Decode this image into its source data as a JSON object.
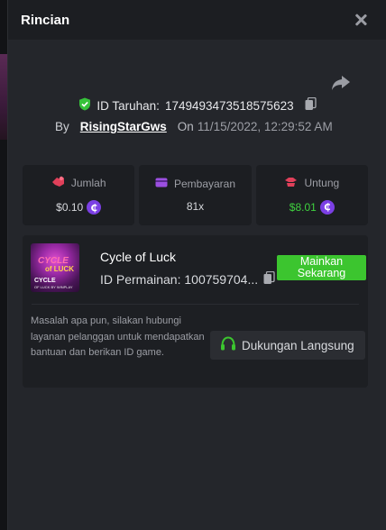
{
  "modal": {
    "title": "Rincian"
  },
  "bet": {
    "id_label": "ID Taruhan:",
    "id_value": "1749493473518575623",
    "by_label": "By",
    "username": "RisingStarGws",
    "on_label": "On",
    "datetime": "11/15/2022, 12:29:52 AM"
  },
  "stats": [
    {
      "label": "Jumlah",
      "value": "$0.10"
    },
    {
      "label": "Pembayaran",
      "value": "81x"
    },
    {
      "label": "Untung",
      "value": "$8.01"
    }
  ],
  "game": {
    "name": "Cycle of Luck",
    "id_text": "ID Permainan: 100759704...",
    "play_label": "Mainkan Sekarang",
    "thumb_text_1": "CYCLE",
    "thumb_text_2": "of LUCK",
    "thumb_text_3": "CYCLE",
    "thumb_text_4": "OF LUCK BY WINPLAY"
  },
  "support": {
    "text": "Masalah apa pun, silakan hubungi layanan pelanggan untuk mendapatkan bantuan dan berikan ID game.",
    "button_label": "Dukungan Langsung"
  },
  "colors": {
    "accent_green": "#3cc52f",
    "profit_green": "#3fd13f",
    "coin_purple": "#7b3fe4",
    "amount_icon_red": "#e0405a"
  }
}
